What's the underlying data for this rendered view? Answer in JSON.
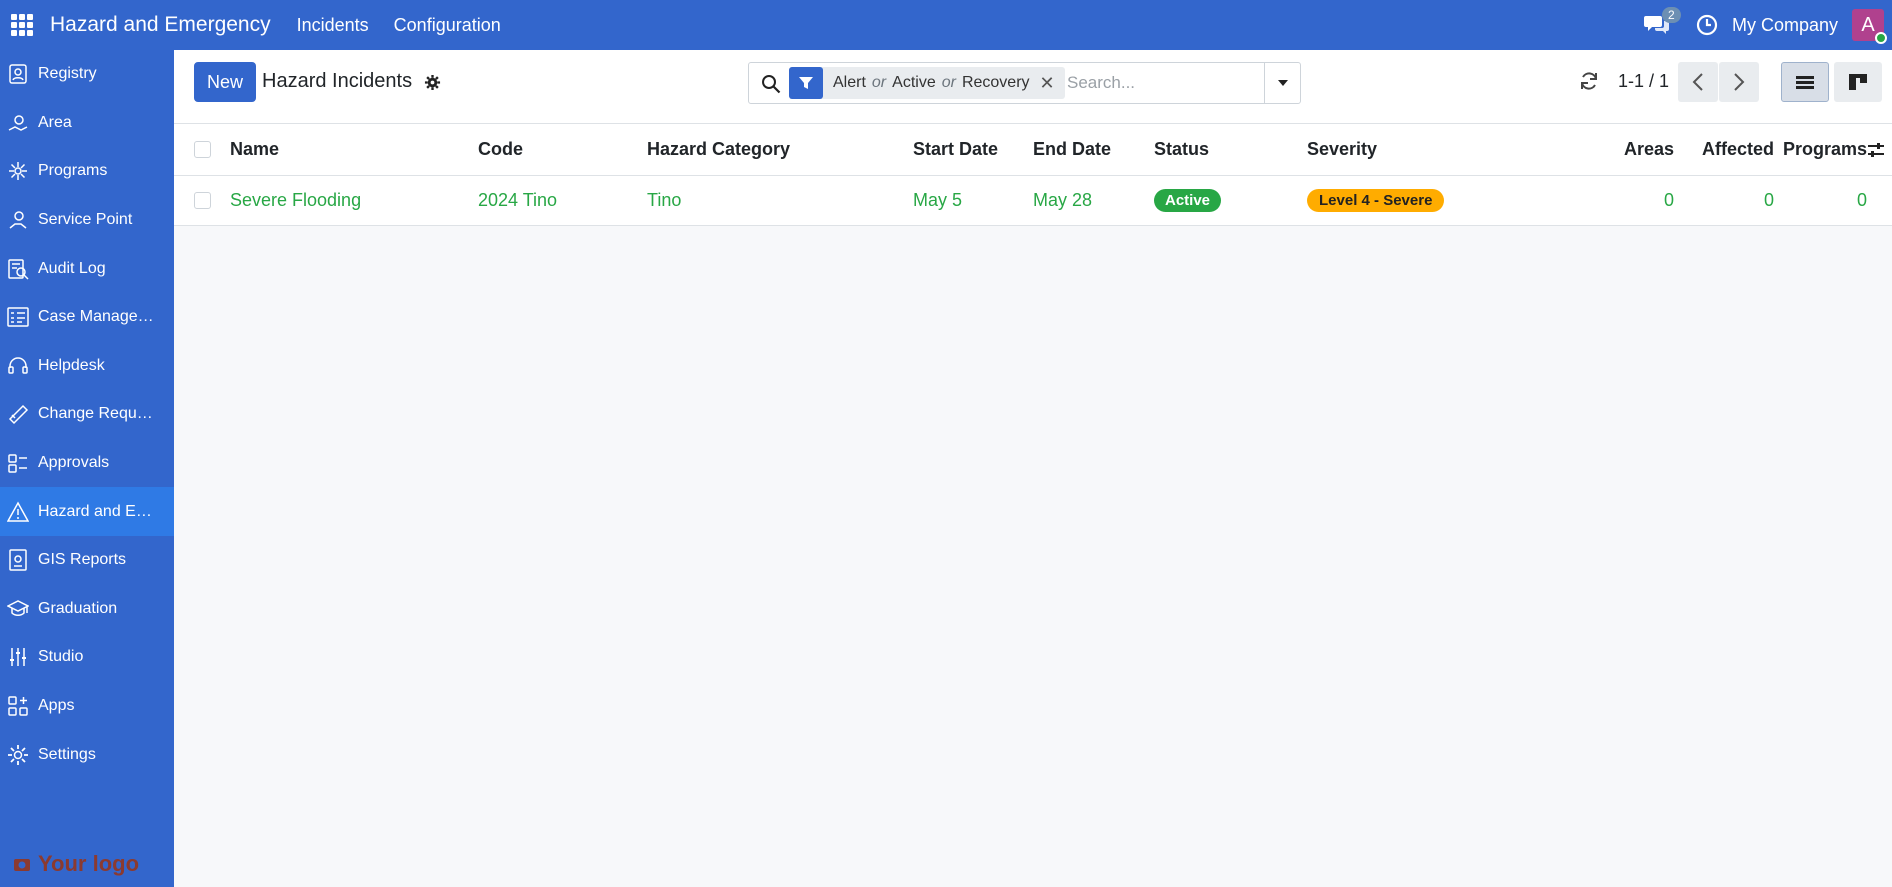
{
  "app": {
    "title": "Hazard and Emergency",
    "menu": [
      "Incidents",
      "Configuration"
    ]
  },
  "topbar": {
    "chat_count": "2",
    "company": "My Company",
    "avatar_letter": "A"
  },
  "sidebar": {
    "items": [
      {
        "label": "Registry",
        "icon": "registry-icon"
      },
      {
        "label": "Area",
        "icon": "area-icon"
      },
      {
        "label": "Programs",
        "icon": "programs-icon"
      },
      {
        "label": "Service Point",
        "icon": "service-point-icon"
      },
      {
        "label": "Audit Log",
        "icon": "audit-log-icon"
      },
      {
        "label": "Case Managem...",
        "icon": "case-management-icon"
      },
      {
        "label": "Helpdesk",
        "icon": "headset-icon"
      },
      {
        "label": "Change Requests",
        "icon": "change-requests-icon"
      },
      {
        "label": "Approvals",
        "icon": "approvals-icon"
      },
      {
        "label": "Hazard and Em...",
        "icon": "warning-icon",
        "active": true
      },
      {
        "label": "GIS Reports",
        "icon": "gis-reports-icon"
      },
      {
        "label": "Graduation",
        "icon": "graduation-cap-icon"
      },
      {
        "label": "Studio",
        "icon": "studio-sliders-icon"
      },
      {
        "label": "Apps",
        "icon": "apps-grid-icon"
      },
      {
        "label": "Settings",
        "icon": "settings-gear-icon"
      }
    ],
    "logo_text": "Your logo"
  },
  "control": {
    "new_label": "New",
    "view_title": "Hazard Incidents",
    "filter_values": [
      "Alert",
      "Active",
      "Recovery"
    ],
    "filter_or": "or",
    "search_placeholder": "Search...",
    "pager": "1-1 / 1"
  },
  "table": {
    "columns": [
      "Name",
      "Code",
      "Hazard Category",
      "Start Date",
      "End Date",
      "Status",
      "Severity",
      "Areas",
      "Affected",
      "Programs"
    ],
    "rows": [
      {
        "name": "Severe Flooding",
        "code": "2024 Tino",
        "category": "Tino",
        "start": "May 5",
        "end": "May 28",
        "status": "Active",
        "severity": "Level 4 - Severe",
        "areas": "0",
        "affected": "0",
        "programs": "0"
      }
    ]
  },
  "colors": {
    "primary": "#3366cc",
    "sidebar_active": "#2f7ae5",
    "row_text": "#28a745",
    "status_active": "#28a745",
    "severity_badge": "#ffac00"
  }
}
